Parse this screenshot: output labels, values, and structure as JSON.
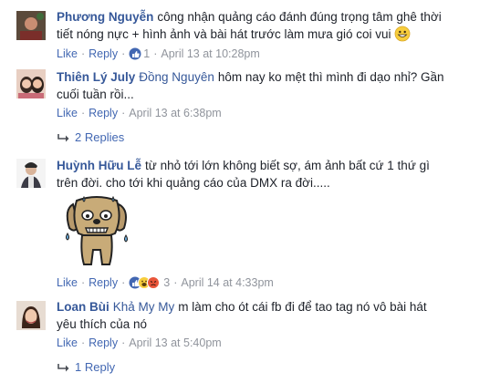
{
  "comments": [
    {
      "author": "Phương Nguyễn",
      "text": "công nhận quảng cáo đánh đúng trọng tâm ghê thời tiết nóng nực + hình ảnh và bài hát trước làm mưa gió coi vui",
      "like_label": "Like",
      "reply_label": "Reply",
      "like_count": "1",
      "timestamp": "April 13 at 10:28pm",
      "emoji": "smile-emoji"
    },
    {
      "author": "Thiên Lý July",
      "tag": "Đồng Nguyên",
      "text": "hôm nay ko mệt thì mình đi dạo nhỉ? Gần cuối tuần rồi...",
      "like_label": "Like",
      "reply_label": "Reply",
      "timestamp": "April 13 at 6:38pm",
      "replies_label": "2 Replies"
    },
    {
      "author": "Huỳnh Hữu Lễ",
      "text": "từ nhỏ tới lớn không biết sợ, ám ảnh bất cứ 1 thứ gì trên đời. cho tới khi quảng cáo của DMX ra đời.....",
      "sticker": "sweating-dog-sticker",
      "like_label": "Like",
      "reply_label": "Reply",
      "reaction_count": "3",
      "timestamp": "April 14 at 4:33pm"
    },
    {
      "author": "Loan Bùi",
      "tag": "Khả My My",
      "text": "m làm cho ót cái fb đi để tao tag nó vô bài hát yêu thích của nó",
      "like_label": "Like",
      "reply_label": "Reply",
      "timestamp": "April 13 at 5:40pm",
      "replies_label": "1 Reply"
    }
  ],
  "colors": {
    "link": "#365899",
    "action": "#4267b2",
    "meta": "#90949c",
    "text": "#1d2129"
  }
}
